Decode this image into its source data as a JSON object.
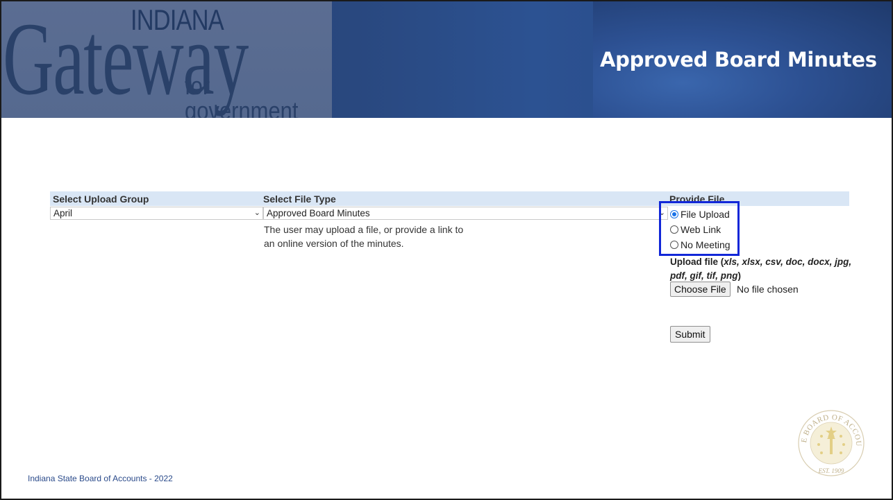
{
  "banner": {
    "logo": {
      "top": "INDIANA",
      "main": "Gateway",
      "sub": "for government units"
    },
    "title": "Approved Board Minutes"
  },
  "form": {
    "headers": {
      "upload_group": "Select Upload Group",
      "file_type": "Select File Type",
      "provide_file": "Provide File"
    },
    "upload_group_value": "April",
    "file_type_value": "Approved Board Minutes",
    "file_type_description_line1": "The user may upload a file, or provide a link to",
    "file_type_description_line2": "an online version of the minutes.",
    "radio_options": [
      {
        "label": "File Upload",
        "selected": true
      },
      {
        "label": "Web Link",
        "selected": false
      },
      {
        "label": "No Meeting",
        "selected": false
      }
    ],
    "upload_label_prefix": "Upload file (",
    "upload_extensions": "xls, xlsx, csv, doc, docx, jpg, pdf, gif, tif, png",
    "upload_label_suffix": ")",
    "choose_file_label": "Choose File",
    "no_file_text": "No file chosen",
    "submit_label": "Submit"
  },
  "footer": {
    "text": "Indiana State Board of Accounts - 2022"
  },
  "seal": {
    "arc_text": "STATE BOARD OF ACCOUNTS",
    "est": "EST. 1909"
  },
  "colors": {
    "highlight_box": "#1127d8",
    "header_row": "#d9e6f5",
    "banner": "#29487f"
  }
}
